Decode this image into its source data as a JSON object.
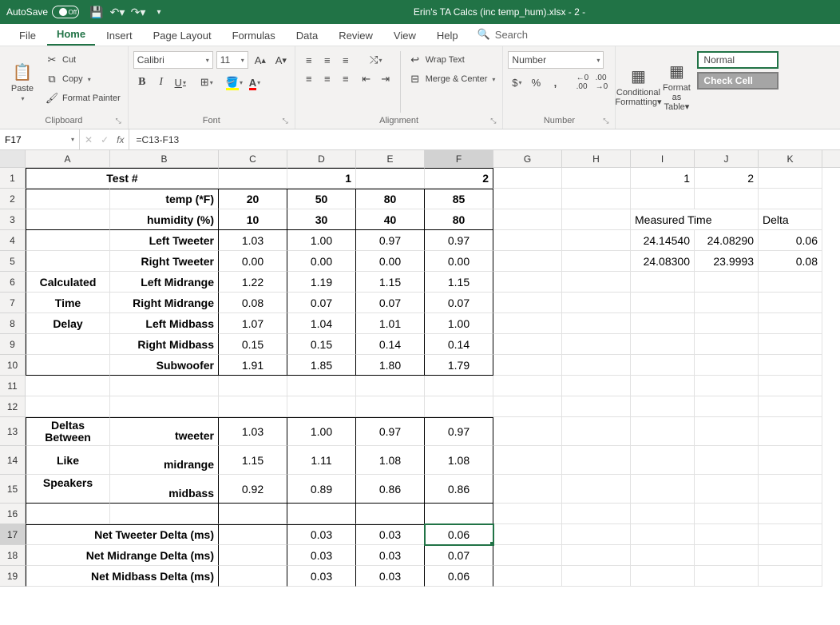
{
  "titlebar": {
    "autosave_label": "AutoSave",
    "autosave_state": "Off",
    "filename": "Erin's TA Calcs (inc temp_hum).xlsx  -  2 -"
  },
  "tabs": {
    "file": "File",
    "home": "Home",
    "insert": "Insert",
    "page_layout": "Page Layout",
    "formulas": "Formulas",
    "data": "Data",
    "review": "Review",
    "view": "View",
    "help": "Help",
    "search": "Search"
  },
  "ribbon": {
    "clipboard": {
      "paste": "Paste",
      "cut": "Cut",
      "copy": "Copy",
      "format_painter": "Format Painter",
      "label": "Clipboard"
    },
    "font": {
      "name": "Calibri",
      "size": "11",
      "bold": "B",
      "italic": "I",
      "underline": "U",
      "label": "Font"
    },
    "alignment": {
      "wrap": "Wrap Text",
      "merge": "Merge & Center",
      "label": "Alignment"
    },
    "number": {
      "format": "Number",
      "label": "Number"
    },
    "styles": {
      "conditional": "Conditional\nFormatting",
      "format_table": "Format as\nTable",
      "normal": "Normal",
      "check": "Check Cell"
    }
  },
  "formula_bar": {
    "name": "F17",
    "formula": "=C13-F13"
  },
  "columns": [
    "A",
    "B",
    "C",
    "D",
    "E",
    "F",
    "G",
    "H",
    "I",
    "J",
    "K"
  ],
  "sheet": {
    "r1": {
      "A": "Test #",
      "D": "1",
      "F": "2",
      "I": "1",
      "J": "2"
    },
    "r2": {
      "B": "temp (*F)",
      "C": "20",
      "D": "50",
      "E": "80",
      "F": "85"
    },
    "r3": {
      "B": "humidity (%)",
      "C": "10",
      "D": "30",
      "E": "40",
      "F": "80",
      "I": "Measured Time",
      "K": "Delta"
    },
    "r4": {
      "B": "Left Tweeter",
      "C": "1.03",
      "D": "1.00",
      "E": "0.97",
      "F": "0.97",
      "I": "24.14540",
      "J": "24.08290",
      "K": "0.06"
    },
    "r5": {
      "B": "Right Tweeter",
      "C": "0.00",
      "D": "0.00",
      "E": "0.00",
      "F": "0.00",
      "I": "24.08300",
      "J": "23.9993",
      "K": "0.08"
    },
    "r6": {
      "A": "Calculated",
      "B": "Left Midrange",
      "C": "1.22",
      "D": "1.19",
      "E": "1.15",
      "F": "1.15"
    },
    "r7": {
      "A": "Time",
      "B": "Right Midrange",
      "C": "0.08",
      "D": "0.07",
      "E": "0.07",
      "F": "0.07"
    },
    "r8": {
      "A": "Delay",
      "B": "Left Midbass",
      "C": "1.07",
      "D": "1.04",
      "E": "1.01",
      "F": "1.00"
    },
    "r9": {
      "B": "Right Midbass",
      "C": "0.15",
      "D": "0.15",
      "E": "0.14",
      "F": "0.14"
    },
    "r10": {
      "B": "Subwoofer",
      "C": "1.91",
      "D": "1.85",
      "E": "1.80",
      "F": "1.79"
    },
    "r13": {
      "A": "Deltas",
      "B": "tweeter",
      "C": "1.03",
      "D": "1.00",
      "E": "0.97",
      "F": "0.97"
    },
    "r13a": {
      "A2": "Between"
    },
    "r14": {
      "A": "Like",
      "B": "midrange",
      "C": "1.15",
      "D": "1.11",
      "E": "1.08",
      "F": "1.08"
    },
    "r15": {
      "A": "Speakers",
      "B": "midbass",
      "C": "0.92",
      "D": "0.89",
      "E": "0.86",
      "F": "0.86"
    },
    "r17": {
      "A": "Net Tweeter Delta (ms)",
      "D": "0.03",
      "E": "0.03",
      "F": "0.06"
    },
    "r18": {
      "A": "Net Midrange Delta (ms)",
      "D": "0.03",
      "E": "0.03",
      "F": "0.07"
    },
    "r19": {
      "A": "Net Midbass Delta (ms)",
      "D": "0.03",
      "E": "0.03",
      "F": "0.06"
    }
  }
}
